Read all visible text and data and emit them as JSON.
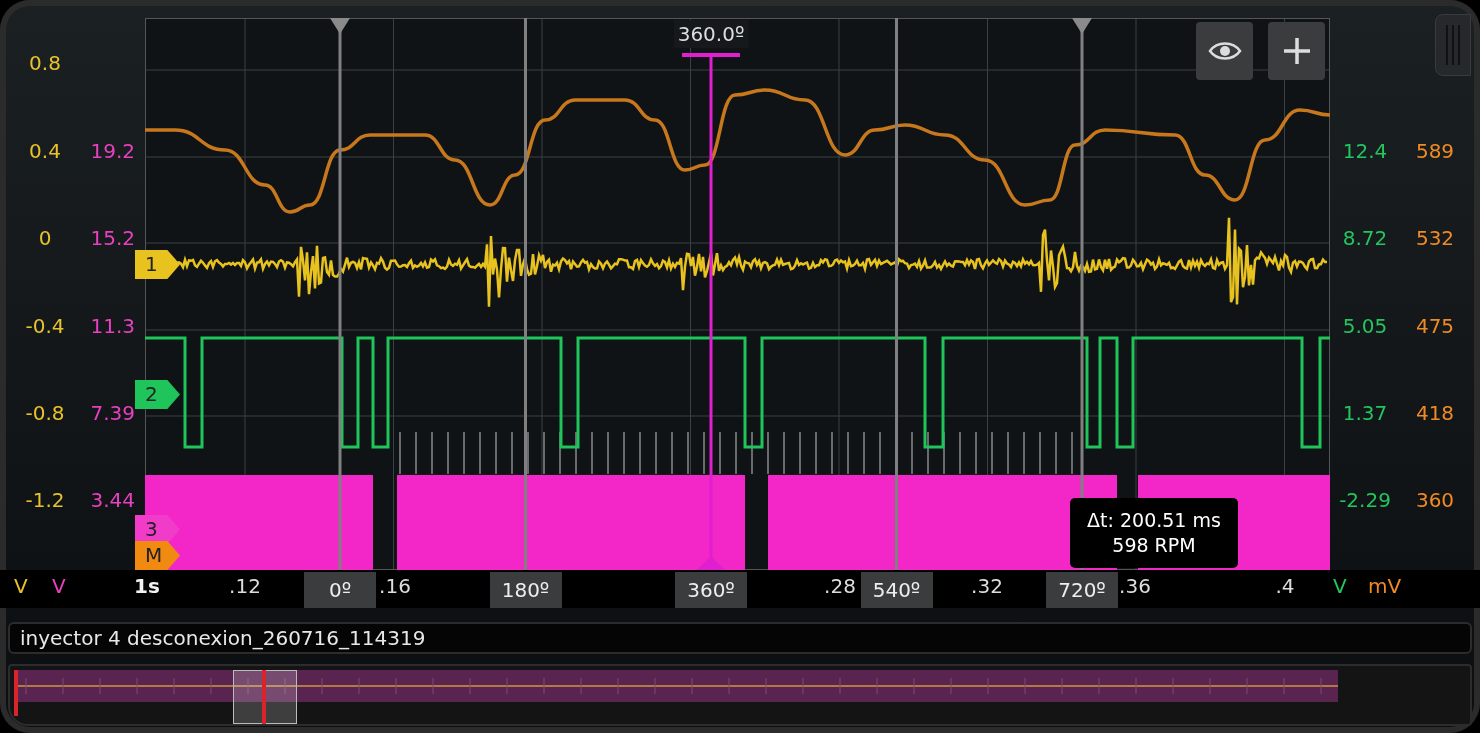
{
  "left_scales": [
    {
      "color": "#e8c22a",
      "unit": "V",
      "ticks": [
        "0.8",
        "0.4",
        "0",
        "-0.4",
        "-0.8",
        "-1.2"
      ]
    },
    {
      "color": "#e840c0",
      "unit": "V",
      "ticks": [
        "19.2",
        "15.2",
        "11.3",
        "7.39",
        "3.44"
      ]
    }
  ],
  "right_scales": [
    {
      "color": "#22c55e",
      "unit": "V",
      "ticks": [
        "12.4",
        "8.72",
        "5.05",
        "1.37",
        "-2.29"
      ]
    },
    {
      "color": "#f08a24",
      "unit": "mV",
      "ticks": [
        "589",
        "532",
        "475",
        "418",
        "360"
      ]
    }
  ],
  "toolbar": [
    {
      "kind": "eye"
    },
    {
      "kind": "add"
    }
  ],
  "channels": [
    {
      "label": "1",
      "color": "#e8c21e"
    },
    {
      "label": "2",
      "color": "#1fc45a"
    },
    {
      "label": "3",
      "color": "#f03cc8"
    },
    {
      "label": "M",
      "color": "#f08a10"
    }
  ],
  "cursor_readout": "360.0º",
  "cursors": [
    {
      "label": "0º",
      "selected": false,
      "top_marker": true
    },
    {
      "label": "180º",
      "selected": false,
      "top_marker": false
    },
    {
      "label": "360º",
      "selected": true,
      "top_marker": false
    },
    {
      "label": "540º",
      "selected": false,
      "top_marker": false
    },
    {
      "label": "720º",
      "selected": false,
      "top_marker": true
    }
  ],
  "time_axis": {
    "start": "1s",
    "ticks": [
      ".12",
      ".16",
      ".28",
      ".32",
      ".36",
      ".4"
    ]
  },
  "measurement": {
    "lines": [
      "Δt: 200.51 ms",
      "598 RPM"
    ]
  },
  "file_name": "inyector 4 desconexion_260716_114319"
}
